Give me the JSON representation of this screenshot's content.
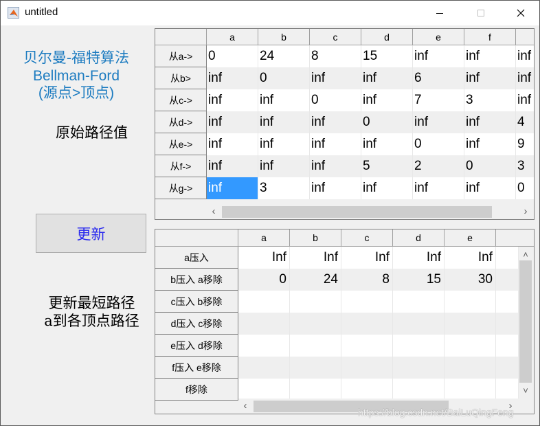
{
  "window": {
    "title": "untitled",
    "minimize_icon": "minimize-icon",
    "maximize_icon": "maximize-icon",
    "close_icon": "close-icon"
  },
  "captions": {
    "algorithm_cn": "贝尔曼-福特算法",
    "algorithm_en": "Bellman-Ford",
    "direction": "(源点>顶点)",
    "original_label": "原始路径值",
    "update_label_line1": "更新最短路径",
    "update_label_line2": "a到各顶点路径"
  },
  "update_button": {
    "label": "更新"
  },
  "colors": {
    "caption_blue": "#1c7bc0",
    "button_text": "#2b2bee",
    "selection": "#3399ff"
  },
  "original_table": {
    "columns": [
      "a",
      "b",
      "c",
      "d",
      "e",
      "f",
      ""
    ],
    "row_headers": [
      "从a->",
      "从b>",
      "从c->",
      "从d->",
      "从e->",
      "从f->",
      "从g->"
    ],
    "rows": [
      [
        "0",
        "24",
        "8",
        "15",
        "inf",
        "inf",
        "inf"
      ],
      [
        "inf",
        "0",
        "inf",
        "inf",
        "6",
        "inf",
        "inf"
      ],
      [
        "inf",
        "inf",
        "0",
        "inf",
        "7",
        "3",
        "inf"
      ],
      [
        "inf",
        "inf",
        "inf",
        "0",
        "inf",
        "inf",
        "4"
      ],
      [
        "inf",
        "inf",
        "inf",
        "inf",
        "0",
        "inf",
        "9"
      ],
      [
        "inf",
        "inf",
        "inf",
        "5",
        "2",
        "0",
        "3"
      ],
      [
        "inf",
        "3",
        "inf",
        "inf",
        "inf",
        "inf",
        "0"
      ]
    ],
    "selected_cell": {
      "row": 6,
      "col": 0
    },
    "scroll_left": "‹",
    "scroll_right": "›"
  },
  "update_table": {
    "columns": [
      "a",
      "b",
      "c",
      "d",
      "e",
      ""
    ],
    "row_headers": [
      "a压入",
      "b压入 a移除",
      "c压入 b移除",
      "d压入 c移除",
      "e压入 d移除",
      "f压入  e移除",
      "f移除"
    ],
    "rows": [
      [
        "Inf",
        "Inf",
        "Inf",
        "Inf",
        "Inf",
        ""
      ],
      [
        "0",
        "24",
        "8",
        "15",
        "30",
        ""
      ],
      [
        "",
        "",
        "",
        "",
        "",
        ""
      ],
      [
        "",
        "",
        "",
        "",
        "",
        ""
      ],
      [
        "",
        "",
        "",
        "",
        "",
        ""
      ],
      [
        "",
        "",
        "",
        "",
        "",
        ""
      ],
      [
        "",
        "",
        "",
        "",
        "",
        ""
      ]
    ],
    "scroll_left": "‹",
    "scroll_right": "›",
    "scroll_up": "˄",
    "scroll_down": "˅"
  },
  "watermark": "https://blog.csdn.net/BaiLuQingFeng"
}
